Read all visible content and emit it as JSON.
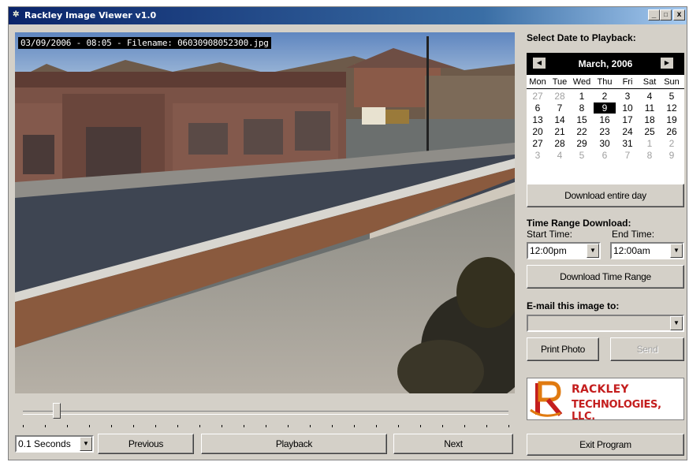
{
  "window": {
    "title": "Rackley Image Viewer v1.0",
    "controls": [
      "_",
      "□",
      "x"
    ]
  },
  "viewer": {
    "caption": "03/09/2006 - 08:05 - Filename: 06030908052300.jpg",
    "slider_position": 0.07
  },
  "playback": {
    "speed_value": "0.1 Seconds",
    "previous_label": "Previous",
    "playback_label": "Playback",
    "next_label": "Next"
  },
  "side": {
    "select_date_label": "Select Date to Playback:",
    "calendar": {
      "month": "March, 2006",
      "day_names": [
        "Mon",
        "Tue",
        "Wed",
        "Thu",
        "Fri",
        "Sat",
        "Sun"
      ],
      "weeks": [
        [
          "27",
          "28",
          "1",
          "2",
          "3",
          "4",
          "5"
        ],
        [
          "6",
          "7",
          "8",
          "9",
          "10",
          "11",
          "12"
        ],
        [
          "13",
          "14",
          "15",
          "16",
          "17",
          "18",
          "19"
        ],
        [
          "20",
          "21",
          "22",
          "23",
          "24",
          "25",
          "26"
        ],
        [
          "27",
          "28",
          "29",
          "30",
          "31",
          "1",
          "2"
        ],
        [
          "3",
          "4",
          "5",
          "6",
          "7",
          "8",
          "9"
        ]
      ],
      "selected_day": "9",
      "out_of_month_first_week": 2,
      "out_of_month_fifth_week_from": 5
    },
    "download_day_label": "Download entire day",
    "time_range_label": "Time Range Download:",
    "start_time_label": "Start Time:",
    "end_time_label": "End Time:",
    "start_time_value": "12:00pm",
    "end_time_value": "12:00am",
    "download_range_label": "Download Time Range",
    "email_label": "E-mail this image to:",
    "email_value": "",
    "print_label": "Print Photo",
    "send_label": "Send",
    "logo_line1": "RACKLEY",
    "logo_line2": "TECHNOLOGIES, LLC.",
    "exit_label": "Exit Program"
  },
  "colors": {
    "titlebar_start": "#0a246a",
    "face": "#d4d0c8",
    "logo_orange": "#e07a10",
    "logo_red": "#c41e1e"
  }
}
